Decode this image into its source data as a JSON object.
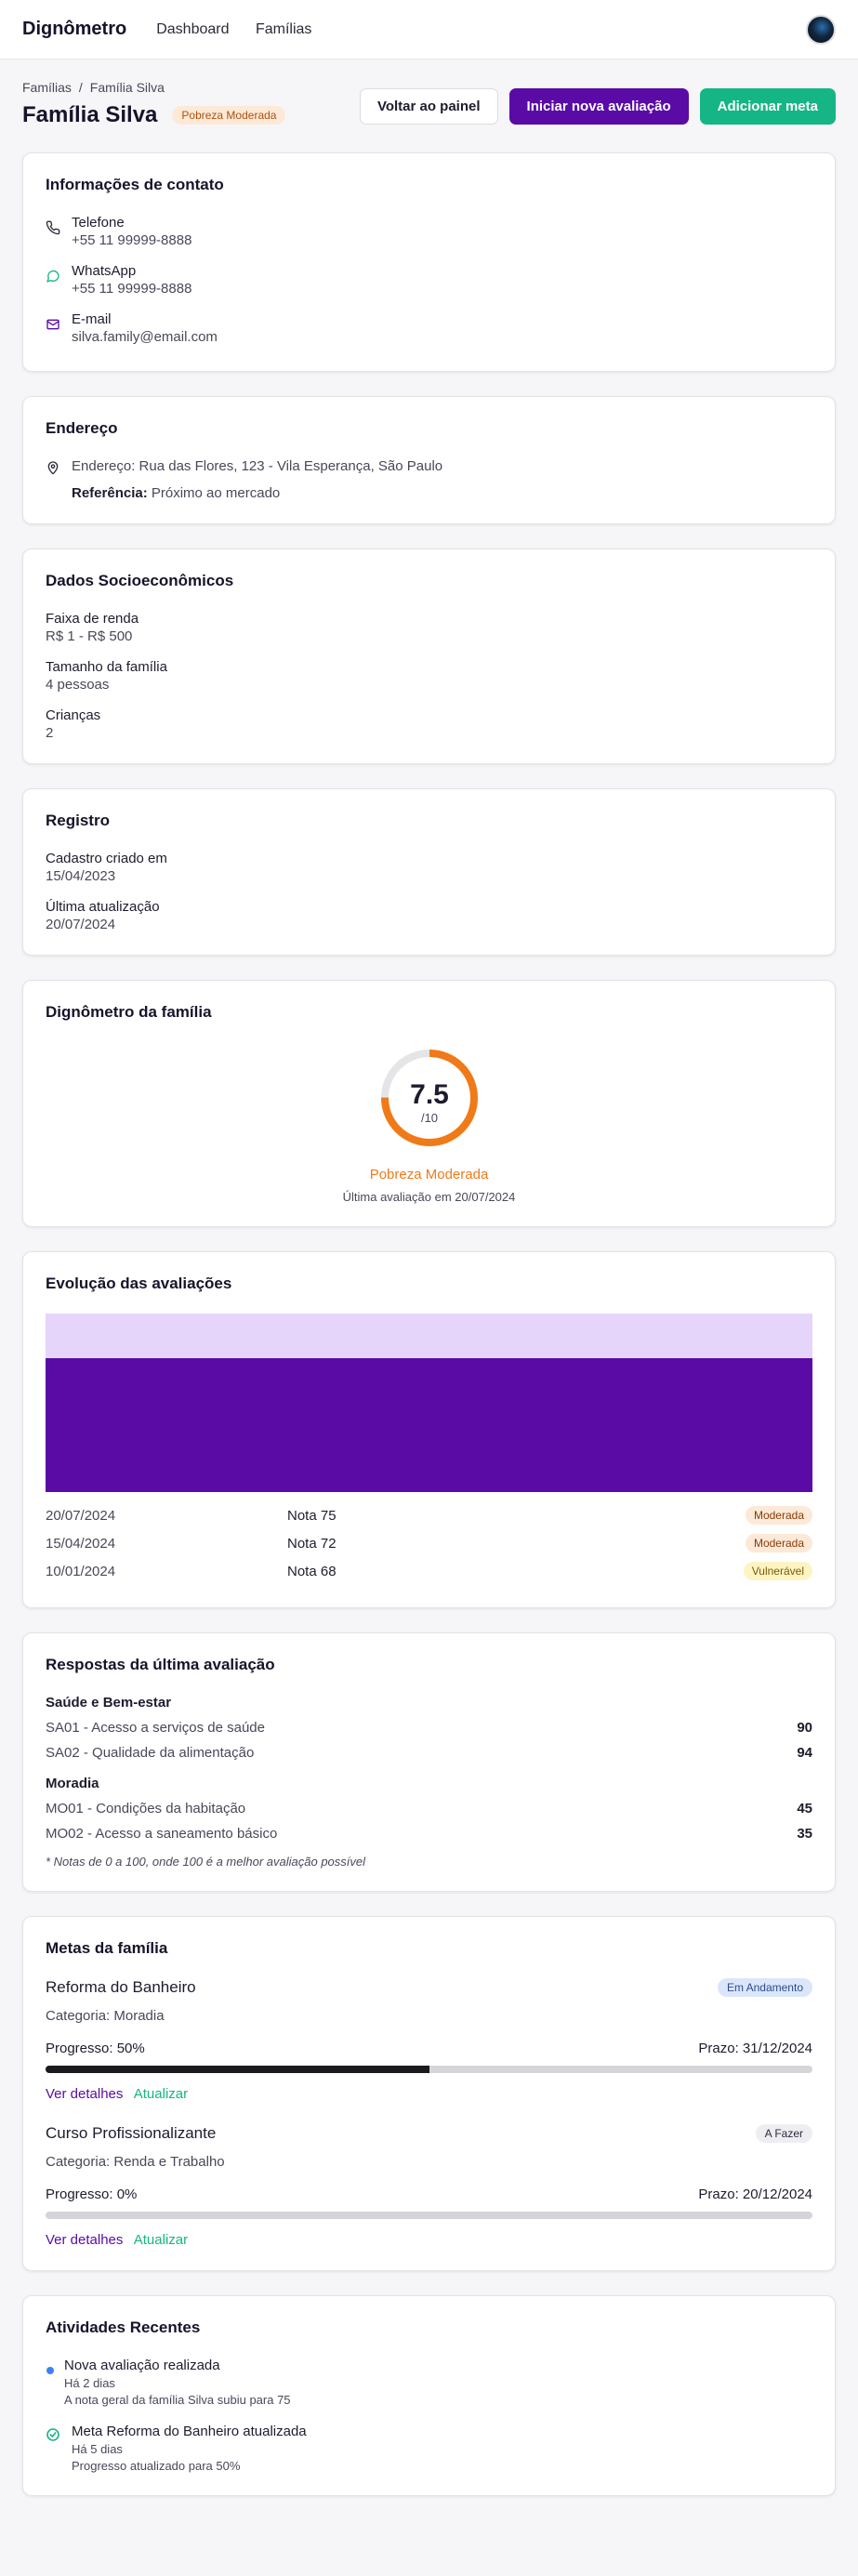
{
  "app": {
    "brand": "Dignômetro",
    "nav": [
      "Dashboard",
      "Famílias"
    ]
  },
  "breadcrumb": {
    "root": "Famílias",
    "current": "Família Silva"
  },
  "header": {
    "title": "Família Silva",
    "badge": "Pobreza Moderada",
    "buttons": {
      "back": "Voltar ao painel",
      "start": "Iniciar nova avaliação",
      "add_goal": "Adicionar meta"
    }
  },
  "contact": {
    "title": "Informações de contato",
    "items": [
      {
        "label": "Telefone",
        "value": "+55 11 99999-8888",
        "icon": "phone-icon"
      },
      {
        "label": "WhatsApp",
        "value": "+55 11 99999-8888",
        "icon": "whatsapp-icon"
      },
      {
        "label": "E-mail",
        "value": "silva.family@email.com",
        "icon": "mail-icon"
      }
    ]
  },
  "address": {
    "title": "Endereço",
    "line": "Endereço: Rua das Flores, 123 - Vila Esperança, São Paulo",
    "ref_label": "Referência:",
    "ref_value": "Próximo ao mercado"
  },
  "socio": {
    "title": "Dados Socioeconômicos",
    "fields": [
      {
        "label": "Faixa de renda",
        "value": "R$ 1 - R$ 500"
      },
      {
        "label": "Tamanho da família",
        "value": "4 pessoas"
      },
      {
        "label": "Crianças",
        "value": "2"
      }
    ]
  },
  "registry": {
    "title": "Registro",
    "fields": [
      {
        "label": "Cadastro criado em",
        "value": "15/04/2023"
      },
      {
        "label": "Última atualização",
        "value": "20/07/2024"
      }
    ]
  },
  "gauge": {
    "title": "Dignômetro da família",
    "score": "7.5",
    "max": "/10",
    "fraction": 0.75,
    "status": "Pobreza Moderada",
    "subtitle": "Última avaliação em 20/07/2024",
    "colors": {
      "ring": "#f07a17",
      "track": "#e5e5e8"
    }
  },
  "evolution": {
    "title": "Evolução das avaliações",
    "chart_fill_fraction": 0.75,
    "colors": {
      "fill": "#5a0ba6",
      "background": "#e6d5fb"
    },
    "history": [
      {
        "date": "20/07/2024",
        "score": "Nota 75",
        "badge": "Moderada",
        "kind": "mod"
      },
      {
        "date": "15/04/2024",
        "score": "Nota 72",
        "badge": "Moderada",
        "kind": "mod"
      },
      {
        "date": "10/01/2024",
        "score": "Nota 68",
        "badge": "Vulnerável",
        "kind": "vul"
      }
    ]
  },
  "answers": {
    "title": "Respostas da última avaliação",
    "categories": [
      {
        "name": "Saúde e Bem-estar",
        "items": [
          {
            "label": "SA01 - Acesso a serviços de saúde",
            "score": "90"
          },
          {
            "label": "SA02 - Qualidade da alimentação",
            "score": "94"
          }
        ]
      },
      {
        "name": "Moradia",
        "items": [
          {
            "label": "MO01 - Condições da habitação",
            "score": "45"
          },
          {
            "label": "MO02 - Acesso a saneamento básico",
            "score": "35"
          }
        ]
      }
    ],
    "note": "* Notas de 0 a 100, onde 100 é a melhor avaliação possível"
  },
  "goals": {
    "title": "Metas da família",
    "items": [
      {
        "title": "Reforma do Banheiro",
        "badge": "Em Andamento",
        "kind": "prog",
        "category": "Categoria: Moradia",
        "progress_label": "Progresso: 50%",
        "progress": 0.5,
        "deadline": "Prazo: 31/12/2024",
        "details": "Ver detalhes",
        "update": "Atualizar"
      },
      {
        "title": "Curso Profissionalizante",
        "badge": "A Fazer",
        "kind": "todo",
        "category": "Categoria: Renda e Trabalho",
        "progress_label": "Progresso: 0%",
        "progress": 0,
        "deadline": "Prazo: 20/12/2024",
        "details": "Ver detalhes",
        "update": "Atualizar"
      }
    ]
  },
  "activities": {
    "title": "Atividades Recentes",
    "items": [
      {
        "title": "Nova avaliação realizada",
        "when": "Há 2 dias",
        "desc": "A nota geral da família Silva subiu para 75",
        "icon": "blue-dot-icon"
      },
      {
        "title": "Meta Reforma do Banheiro atualizada",
        "when": "Há 5 dias",
        "desc": "Progresso atualizado para 50%",
        "icon": "check-circle-icon"
      }
    ]
  }
}
